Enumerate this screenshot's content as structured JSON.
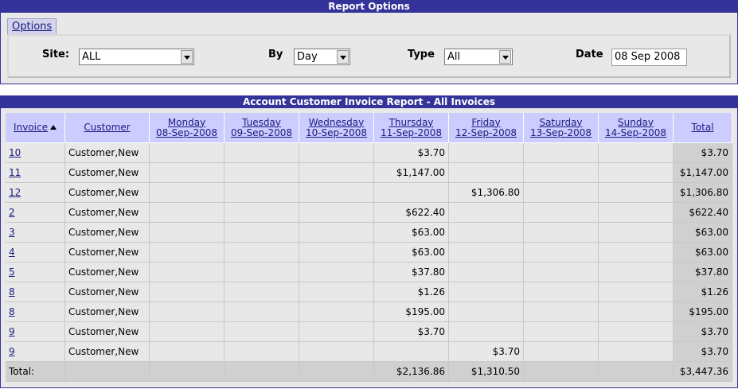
{
  "options": {
    "header": "Report Options",
    "tab_label": "Options",
    "site_label": "Site:",
    "site_value": "ALL",
    "by_label": "By",
    "by_value": "Day",
    "type_label": "Type",
    "type_value": "All",
    "date_label": "Date",
    "date_value": "08 Sep 2008"
  },
  "report": {
    "header": "Account Customer Invoice Report - All Invoices",
    "columns": {
      "invoice": "Invoice",
      "customer": "Customer",
      "mon_day": "Monday",
      "mon_date": "08-Sep-2008",
      "tue_day": "Tuesday",
      "tue_date": "09-Sep-2008",
      "wed_day": "Wednesday",
      "wed_date": "10-Sep-2008",
      "thu_day": "Thursday",
      "thu_date": "11-Sep-2008",
      "fri_day": "Friday",
      "fri_date": "12-Sep-2008",
      "sat_day": "Saturday",
      "sat_date": "13-Sep-2008",
      "sun_day": "Sunday",
      "sun_date": "14-Sep-2008",
      "total": "Total"
    },
    "rows": [
      {
        "invoice": "10",
        "customer": "Customer,New",
        "days": [
          "",
          "",
          "",
          "$3.70",
          "",
          "",
          ""
        ],
        "total": "$3.70"
      },
      {
        "invoice": "11",
        "customer": "Customer,New",
        "days": [
          "",
          "",
          "",
          "$1,147.00",
          "",
          "",
          ""
        ],
        "total": "$1,147.00"
      },
      {
        "invoice": "12",
        "customer": "Customer,New",
        "days": [
          "",
          "",
          "",
          "",
          "$1,306.80",
          "",
          ""
        ],
        "total": "$1,306.80"
      },
      {
        "invoice": "2",
        "customer": "Customer,New",
        "days": [
          "",
          "",
          "",
          "$622.40",
          "",
          "",
          ""
        ],
        "total": "$622.40"
      },
      {
        "invoice": "3",
        "customer": "Customer,New",
        "days": [
          "",
          "",
          "",
          "$63.00",
          "",
          "",
          ""
        ],
        "total": "$63.00"
      },
      {
        "invoice": "4",
        "customer": "Customer,New",
        "days": [
          "",
          "",
          "",
          "$63.00",
          "",
          "",
          ""
        ],
        "total": "$63.00"
      },
      {
        "invoice": "5",
        "customer": "Customer,New",
        "days": [
          "",
          "",
          "",
          "$37.80",
          "",
          "",
          ""
        ],
        "total": "$37.80"
      },
      {
        "invoice": "8",
        "customer": "Customer,New",
        "days": [
          "",
          "",
          "",
          "$1.26",
          "",
          "",
          ""
        ],
        "total": "$1.26"
      },
      {
        "invoice": "8",
        "customer": "Customer,New",
        "days": [
          "",
          "",
          "",
          "$195.00",
          "",
          "",
          ""
        ],
        "total": "$195.00"
      },
      {
        "invoice": "9",
        "customer": "Customer,New",
        "days": [
          "",
          "",
          "",
          "$3.70",
          "",
          "",
          ""
        ],
        "total": "$3.70"
      },
      {
        "invoice": "9",
        "customer": "Customer,New",
        "days": [
          "",
          "",
          "",
          "",
          "$3.70",
          "",
          ""
        ],
        "total": "$3.70"
      }
    ],
    "totals": {
      "label": "Total:",
      "days": [
        "",
        "",
        "",
        "$2,136.86",
        "$1,310.50",
        "",
        ""
      ],
      "total": "$3,447.36"
    },
    "sort_icon": "sort-ascending-icon"
  }
}
